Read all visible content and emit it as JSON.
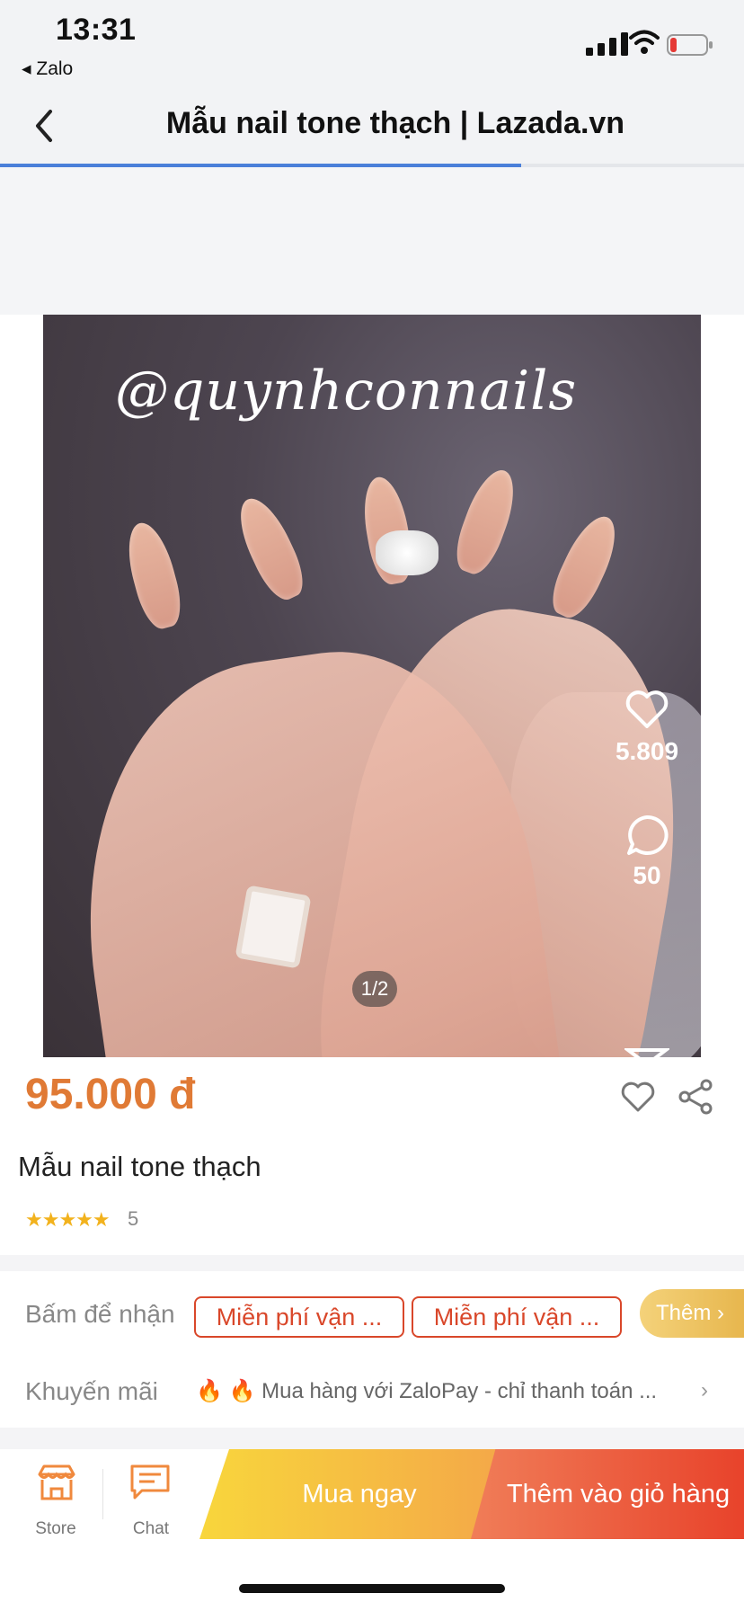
{
  "status_bar": {
    "time": "13:31",
    "back_app": "◂ Zalo"
  },
  "header": {
    "title": "Mẫu nail tone thạch | Lazada.vn",
    "load_progress": 0.7
  },
  "product": {
    "image_watermark": "@quynhconnails",
    "image_counter": "1/2",
    "likes": "5.809",
    "comments": "50",
    "price": "95.000 đ",
    "name": "Mẫu nail tone thạch",
    "stars": "★★★★★",
    "rating": "5"
  },
  "offers": {
    "claim_label": "Bấm để nhận",
    "vouchers": [
      "Miễn phí vận ...",
      "Miễn phí vận ..."
    ],
    "more_label": "Thêm",
    "promo_label": "Khuyến mãi",
    "promo_text": "🔥 🔥 Mua hàng với ZaloPay - chỉ thanh toán ..."
  },
  "bottom_bar": {
    "store_label": "Store",
    "chat_label": "Chat",
    "buy_now_label": "Mua ngay",
    "add_to_cart_label": "Thêm vào giỏ hàng"
  },
  "colors": {
    "accent": "#e07a35",
    "voucher": "#d9472a",
    "progress": "#4a7fd9"
  }
}
